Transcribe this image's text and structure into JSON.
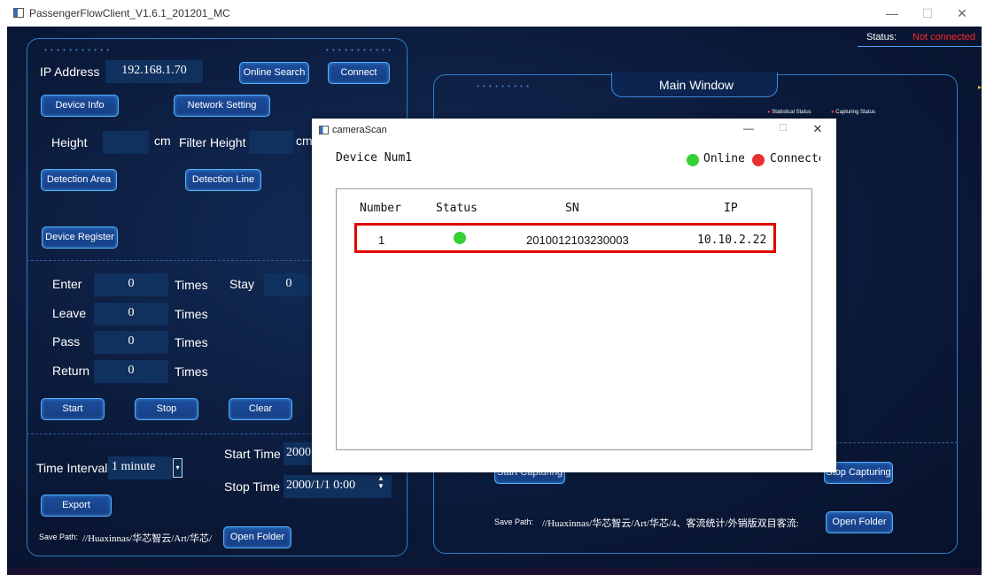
{
  "window": {
    "title": "PassengerFlowClient_V1.6.1_201201_MC",
    "min_glyph": "—",
    "max_glyph": "☐",
    "close_glyph": "✕"
  },
  "status": {
    "label": "Status:",
    "value": "Not connected",
    "value_color": "#ff2a2a"
  },
  "left_panel": {
    "ip_label": "IP Address",
    "ip_value": "192.168.1.70",
    "online_search": "Online Search",
    "connect": "Connect",
    "device_info": "Device Info",
    "network_setting": "Network Setting",
    "height_label": "Height",
    "height_unit": "cm",
    "filter_height_label": "Filter Height",
    "filter_height_unit": "cm",
    "detection_area": "Detection Area",
    "detection_line": "Detection Line",
    "device_register": "Device Register",
    "counters": [
      {
        "label": "Enter",
        "value": "0",
        "unit": "Times"
      },
      {
        "label": "Leave",
        "value": "0",
        "unit": "Times"
      },
      {
        "label": "Pass",
        "value": "0",
        "unit": "Times"
      },
      {
        "label": "Return",
        "value": "0",
        "unit": "Times"
      }
    ],
    "stay_label": "Stay",
    "stay_value": "0",
    "start": "Start",
    "stop": "Stop",
    "clear": "Clear",
    "time_interval_label": "Time Interval",
    "time_interval_value": "1 minute",
    "start_time_label": "Start Time",
    "start_time_value": "2000",
    "stop_time_label": "Stop Time",
    "stop_time_value": "2000/1/1 0:00",
    "export": "Export",
    "save_path_label": "Save Path:",
    "save_path_value": "//Huaxinnas/华芯智云/Art/华芯/",
    "open_folder": "Open Folder"
  },
  "right_panel": {
    "title": "Main Window",
    "legend_statistical": "Statistical Status",
    "legend_capturing": "Capturing Status",
    "start_capturing": "Start Capturing",
    "stop_capturing": "Stop Capturing",
    "save_path_label": "Save Path:",
    "save_path_value": "//Huaxinnas/华芯智云/Art/华芯/4、客流统计/外销版双目客流:",
    "open_folder": "Open Folder"
  },
  "dialog": {
    "title": "cameraScan",
    "device_num": "Device Num1",
    "legend_online": "Online",
    "legend_connected": "Connecte",
    "online_color": "#34d034",
    "connected_color": "#e83030",
    "headers": [
      "Number",
      "Status",
      "SN",
      "IP"
    ],
    "rows": [
      {
        "number": "1",
        "status": "online",
        "sn": "2010012103230003",
        "ip": "10.10.2.22"
      }
    ]
  }
}
